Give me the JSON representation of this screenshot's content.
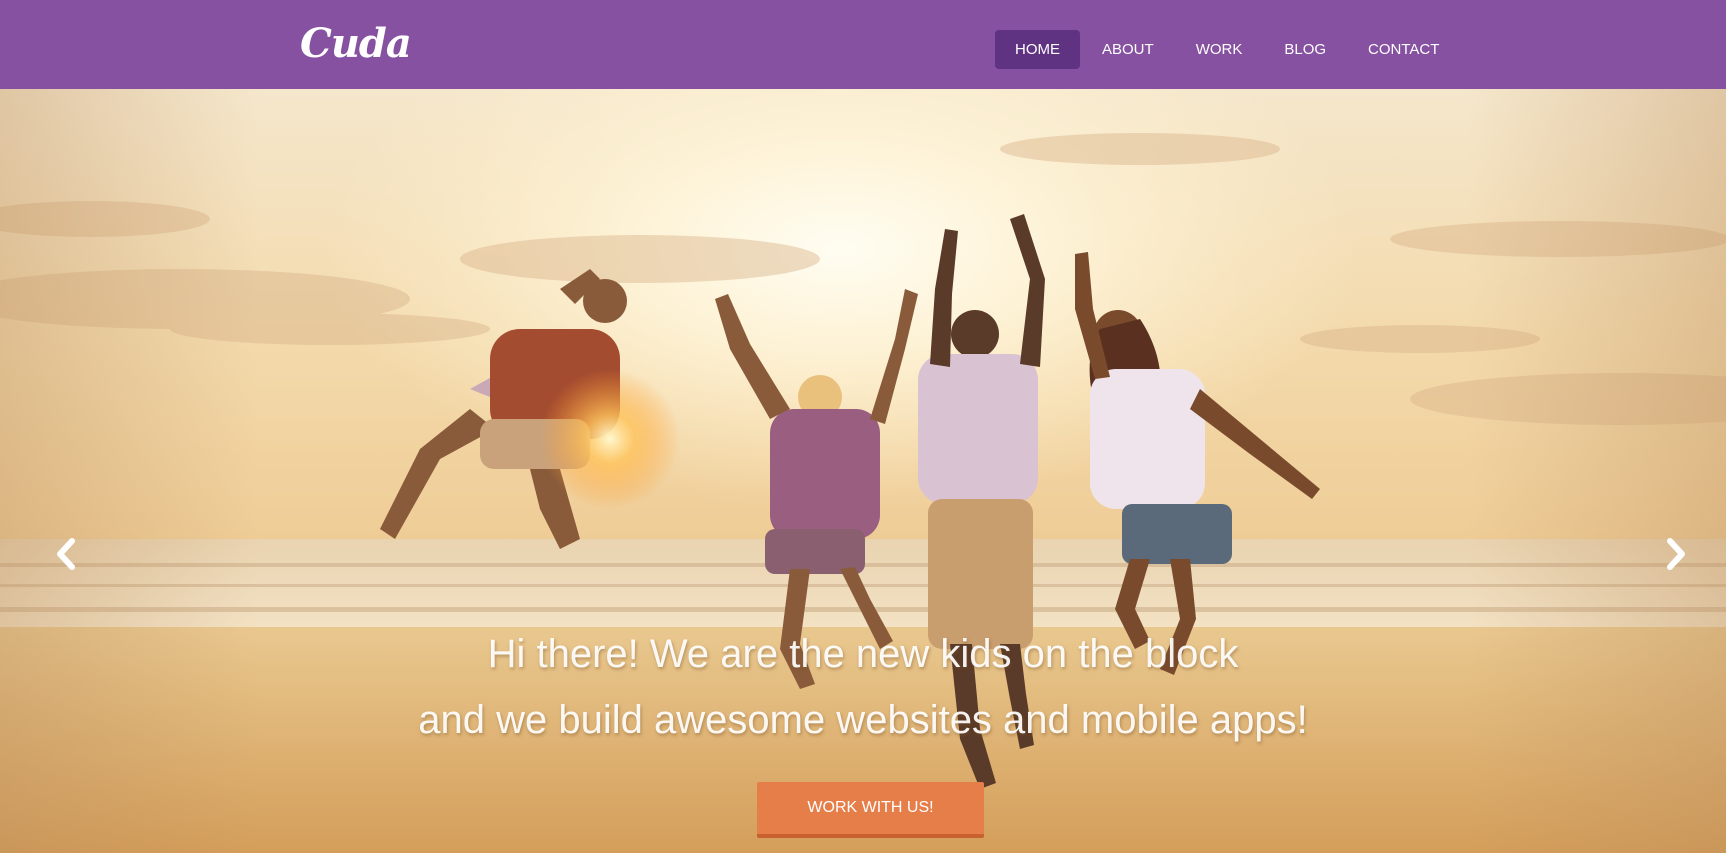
{
  "brand": {
    "logo_text": "Cuda"
  },
  "nav": {
    "items": [
      {
        "label": "HOME",
        "active": true
      },
      {
        "label": "ABOUT",
        "active": false
      },
      {
        "label": "WORK",
        "active": false
      },
      {
        "label": "BLOG",
        "active": false
      },
      {
        "label": "CONTACT",
        "active": false
      }
    ]
  },
  "hero": {
    "caption_line1": "Hi there! We are the new kids on the block",
    "caption_line2": "and we build awesome websites and mobile apps!",
    "cta_label": "WORK WITH US!",
    "prev_icon": "chevron-left-icon",
    "next_icon": "chevron-right-icon"
  },
  "colors": {
    "navbar": "#8651a0",
    "nav_active": "#5f3381",
    "cta": "#e67e4a"
  }
}
